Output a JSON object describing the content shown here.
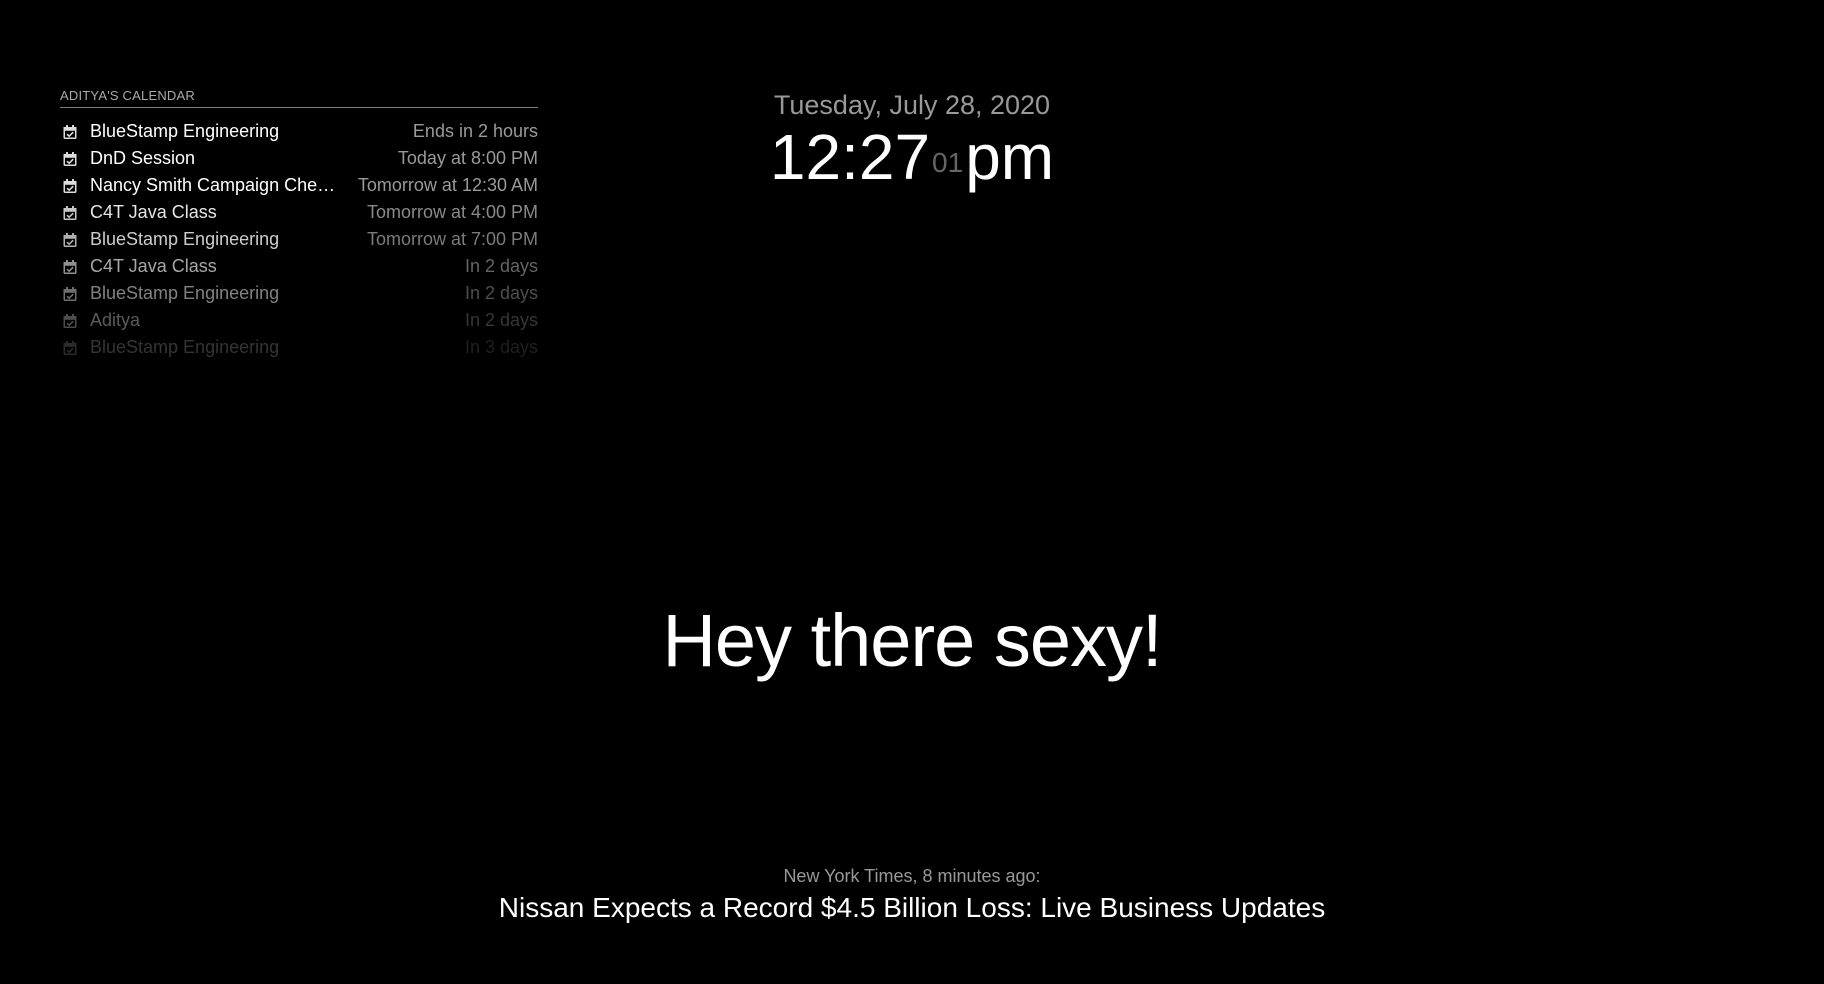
{
  "calendar": {
    "header": "ADITYA'S CALENDAR",
    "events": [
      {
        "title": "BlueStamp Engineering",
        "time": "Ends in 2 hours",
        "opacity": 1.0
      },
      {
        "title": "DnD Session",
        "time": "Today at 8:00 PM",
        "opacity": 1.0
      },
      {
        "title": "Nancy Smith Campaign Chec…",
        "time": "Tomorrow at 12:30 AM",
        "opacity": 1.0
      },
      {
        "title": "C4T Java Class",
        "time": "Tomorrow at 4:00 PM",
        "opacity": 0.9
      },
      {
        "title": "BlueStamp Engineering",
        "time": "Tomorrow at 7:00 PM",
        "opacity": 0.8
      },
      {
        "title": "C4T Java Class",
        "time": "In 2 days",
        "opacity": 0.65
      },
      {
        "title": "BlueStamp Engineering",
        "time": "In 2 days",
        "opacity": 0.5
      },
      {
        "title": "Aditya",
        "time": "In 2 days",
        "opacity": 0.35
      },
      {
        "title": "BlueStamp Engineering",
        "time": "In 3 days",
        "opacity": 0.2
      }
    ],
    "icon": "calendar-check-icon"
  },
  "clock": {
    "date": "Tuesday, July 28, 2020",
    "hours_minutes": "12:27",
    "seconds": "01",
    "ampm": "pm"
  },
  "compliment": {
    "text": "Hey there sexy!"
  },
  "news": {
    "source": "New York Times, 8 minutes ago:",
    "headline": "Nissan Expects a Record $4.5 Billion Loss: Live Business Updates"
  }
}
